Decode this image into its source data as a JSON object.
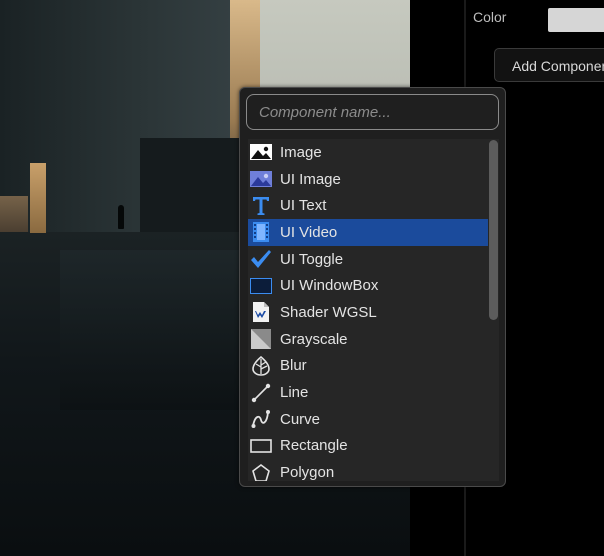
{
  "inspector": {
    "color_label": "Color",
    "color_value": "#d6d6d6",
    "add_component_label": "Add Component"
  },
  "popup": {
    "search_placeholder": "Component name...",
    "search_value": "",
    "items": [
      {
        "label": "Image",
        "icon": "image-icon",
        "selected": false
      },
      {
        "label": "UI Image",
        "icon": "ui-image-icon",
        "selected": false
      },
      {
        "label": "UI Text",
        "icon": "text-t-icon",
        "selected": false
      },
      {
        "label": "UI Video",
        "icon": "video-film-icon",
        "selected": true
      },
      {
        "label": "UI Toggle",
        "icon": "checkmark-icon",
        "selected": false
      },
      {
        "label": "UI WindowBox",
        "icon": "window-box-icon",
        "selected": false
      },
      {
        "label": "Shader WGSL",
        "icon": "shader-file-icon",
        "selected": false
      },
      {
        "label": "Grayscale",
        "icon": "grayscale-icon",
        "selected": false
      },
      {
        "label": "Blur",
        "icon": "blur-leaf-icon",
        "selected": false
      },
      {
        "label": "Line",
        "icon": "line-icon",
        "selected": false
      },
      {
        "label": "Curve",
        "icon": "curve-icon",
        "selected": false
      },
      {
        "label": "Rectangle",
        "icon": "rectangle-icon",
        "selected": false
      },
      {
        "label": "Polygon",
        "icon": "polygon-icon",
        "selected": false
      }
    ],
    "selected_color": "#1b4b9c"
  }
}
